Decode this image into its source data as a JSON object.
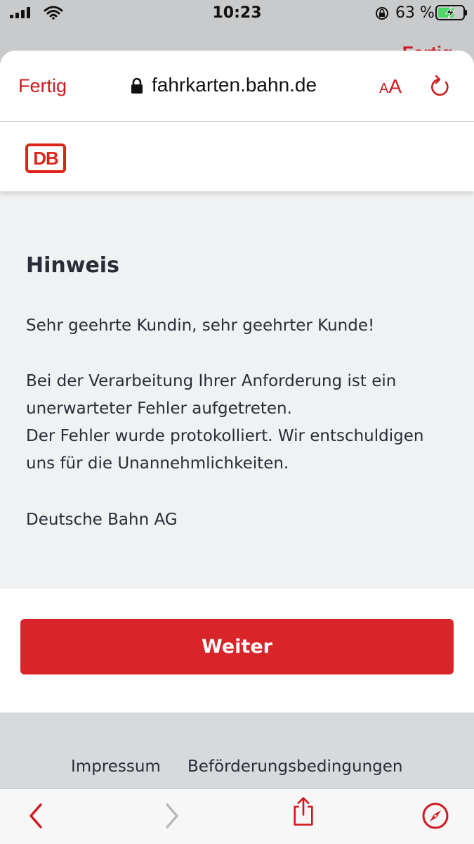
{
  "status_bar": {
    "time": "10:23",
    "battery_percent": "63 %"
  },
  "browser": {
    "behind_sheet_label": "Fertig",
    "done_label": "Fertig",
    "domain": "fahrkarten.bahn.de",
    "text_size_label_small": "A",
    "text_size_label_large": "A"
  },
  "site": {
    "logo_text": "DB",
    "title": "Hinweis",
    "greeting": "Sehr geehrte Kundin, sehr geehrter Kunde!",
    "message_lines": [
      "Bei der Verarbeitung Ihrer Anforderung ist ein",
      "unerwarteter Fehler aufgetreten.",
      "Der Fehler wurde protokolliert. Wir entschuldigen",
      "uns für die Unannehmlichkeiten."
    ],
    "signature": "Deutsche Bahn AG",
    "button_label": "Weiter",
    "footer_links": [
      "Impressum",
      "Beförderungsbedingungen"
    ]
  },
  "colors": {
    "accent": "#d0191e",
    "db_red": "#e0231b",
    "button": "#d9252a",
    "text": "#282d37"
  },
  "icons": [
    "signal-icon",
    "wifi-icon",
    "rotation-lock-icon",
    "battery-icon",
    "lock-icon",
    "reload-icon",
    "back-icon",
    "forward-icon",
    "share-icon",
    "compass-icon"
  ]
}
